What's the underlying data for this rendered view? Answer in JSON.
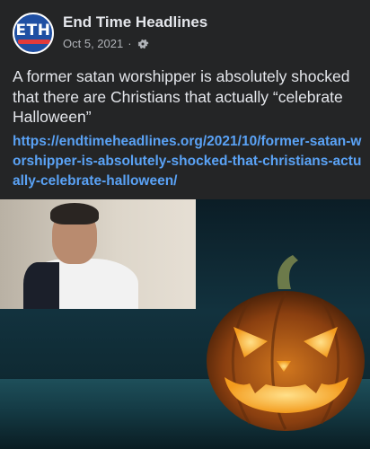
{
  "page": {
    "name": "End Time Headlines",
    "date": "Oct 5, 2021",
    "separator": "·",
    "audience_icon": "gear-icon",
    "avatar_logo_text": "ETH"
  },
  "post": {
    "text": "A former satan worshipper is absolutely shocked that there are Christians that actually “celebrate Halloween”",
    "link": "https://endtimeheadlines.org/2021/10/former-satan-worshipper-is-absolutely-shocked-that-christians-actually-celebrate-halloween/"
  },
  "image": {
    "subject_icons": [
      "man-speaking-photo",
      "jack-o-lantern-icon"
    ]
  },
  "colors": {
    "background": "#242526",
    "text": "#e4e6eb",
    "meta": "#b0b3b8",
    "link": "#5aa2f5"
  }
}
